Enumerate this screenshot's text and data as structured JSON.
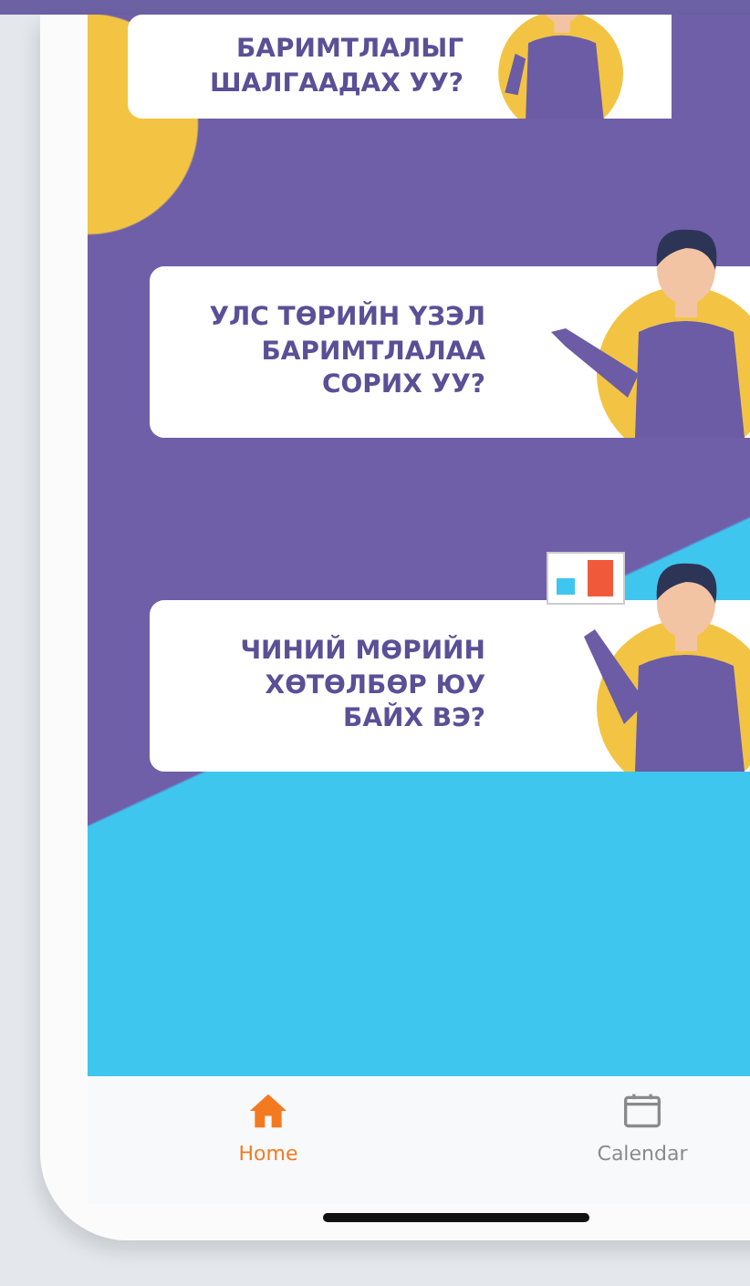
{
  "cards": [
    {
      "text": "БАРИМТЛАЛЫГ\nШАЛГААДАХ УУ?",
      "kind": "standing"
    },
    {
      "text": "УЛС ТӨРИЙН ҮЗЭЛ\nБАРИМТЛАЛАА\nСОРИХ УУ?",
      "kind": "pointing"
    },
    {
      "text": "ЧИНИЙ МӨРИЙН\nХӨТӨЛБӨР ЮУ\nБАЙХ ВЭ?",
      "kind": "screen"
    }
  ],
  "nav": [
    {
      "label": "Home",
      "kind": "home",
      "selected": true
    },
    {
      "label": "Calendar",
      "kind": "calendar",
      "selected": false
    }
  ]
}
